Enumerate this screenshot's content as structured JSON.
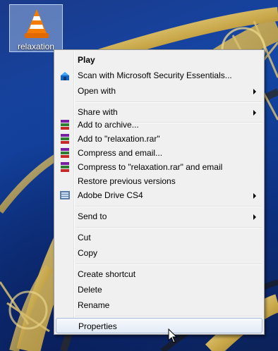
{
  "desktop": {
    "icon": {
      "label": "relaxation",
      "icon": "vlc-cone-icon"
    }
  },
  "context_menu": {
    "items": [
      {
        "label": "Play",
        "bold": true
      },
      {
        "label": "Scan with Microsoft Security Essentials...",
        "icon": "security-essentials-icon"
      },
      {
        "label": "Open with",
        "submenu": true
      },
      {
        "label": "Share with",
        "submenu": true
      },
      {
        "label": "Add to archive...",
        "icon": "winrar-icon"
      },
      {
        "label": "Add to \"relaxation.rar\"",
        "icon": "winrar-icon"
      },
      {
        "label": "Compress and email...",
        "icon": "winrar-icon"
      },
      {
        "label": "Compress to \"relaxation.rar\" and email",
        "icon": "winrar-icon"
      },
      {
        "label": "Restore previous versions"
      },
      {
        "label": "Adobe Drive CS4",
        "icon": "adobe-drive-icon",
        "submenu": true
      },
      {
        "label": "Send to",
        "submenu": true
      },
      {
        "label": "Cut"
      },
      {
        "label": "Copy"
      },
      {
        "label": "Create shortcut"
      },
      {
        "label": "Delete"
      },
      {
        "label": "Rename"
      },
      {
        "label": "Properties",
        "highlighted": true
      }
    ]
  }
}
